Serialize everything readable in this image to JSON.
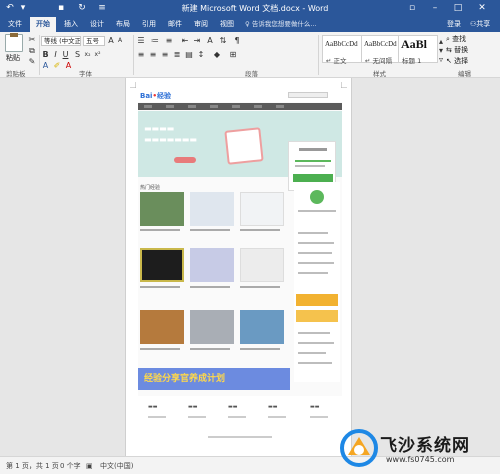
{
  "window": {
    "title": "新建 Microsoft Word 文档.docx - Word"
  },
  "ribbon": {
    "tabs": [
      "文件",
      "开始",
      "插入",
      "设计",
      "布局",
      "引用",
      "邮件",
      "审阅",
      "视图"
    ],
    "active_tab": "开始",
    "tell_me_placeholder": "告诉我您想要做什么...",
    "login": "登录",
    "share": "共享",
    "clipboard": {
      "paste": "粘贴",
      "group_label": "剪贴板"
    },
    "font": {
      "name": "等线 (中文正)",
      "size": "五号",
      "group_label": "字体"
    },
    "paragraph": {
      "group_label": "段落"
    },
    "styles": {
      "group_label": "样式",
      "items": [
        {
          "sample": "AaBbCcDd",
          "name": "正文"
        },
        {
          "sample": "AaBbCcDd",
          "name": "无间隔"
        },
        {
          "sample": "AaBl",
          "name": "标题 1"
        }
      ]
    },
    "editing": {
      "find": "查找",
      "replace": "替换",
      "select": "选择",
      "group_label": "编辑"
    }
  },
  "document": {
    "embedded_page": {
      "section_title": "热门经验",
      "banner_text": "经验分享官养成计划"
    }
  },
  "statusbar": {
    "page": "第 1 页，共 1 页",
    "words": "0 个字",
    "language": "中文(中国)"
  },
  "watermark": {
    "name": "飞沙系统网",
    "url": "www.fs0745.com"
  },
  "colors": {
    "accent": "#2b579a",
    "canvas": "#e6e6e6"
  }
}
